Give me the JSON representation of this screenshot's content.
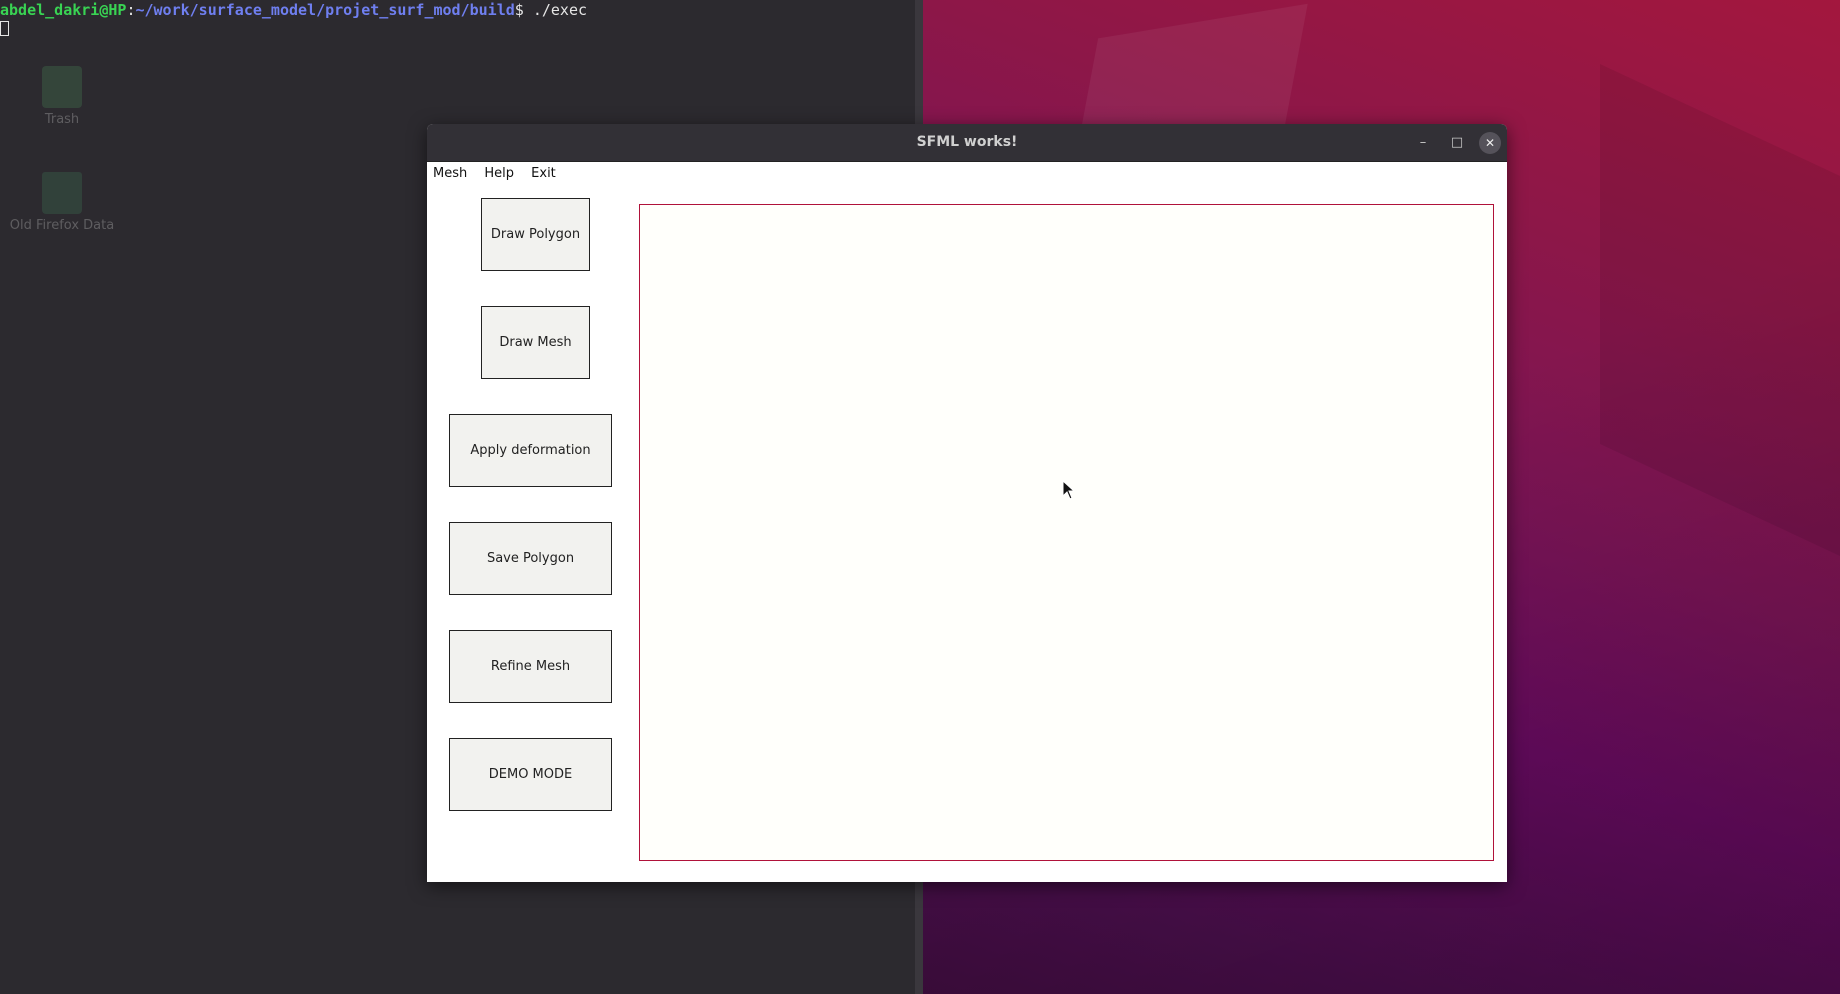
{
  "terminal": {
    "user_host": "abdel_dakri@HP",
    "separator": ":",
    "path": "~/work/surface_model/projet_surf_mod/build",
    "prompt_symbol": "$",
    "command": " ./exec"
  },
  "desktop": {
    "icons": [
      {
        "label": "Trash",
        "icon": "trash-icon"
      },
      {
        "label": "Old Firefox Data",
        "icon": "folder-icon"
      }
    ]
  },
  "window": {
    "title": "SFML works!",
    "controls": {
      "minimize": "–",
      "maximize": "□",
      "close": "✕"
    },
    "menu": [
      "Mesh",
      "Help",
      "Exit"
    ],
    "buttons": {
      "draw_polygon": "Draw Polygon",
      "draw_mesh": "Draw Mesh",
      "apply_deformation": "Apply deformation",
      "save_polygon": "Save Polygon",
      "refine_mesh": "Refine Mesh",
      "demo_mode": "DEMO MODE"
    },
    "canvas_border_color": "#b0123a"
  },
  "colors": {
    "terminal_user": "#39d353",
    "terminal_path": "#6f7ff0",
    "wallpaper_primary": "#8d1748"
  }
}
